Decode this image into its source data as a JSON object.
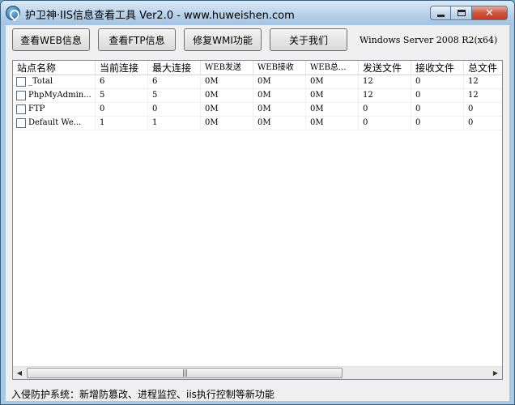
{
  "window": {
    "title": "护卫神·IIS信息查看工具 Ver2.0 - www.huweishen.com",
    "close_glyph": "✕"
  },
  "toolbar": {
    "web_info_label": "查看WEB信息",
    "ftp_info_label": "查看FTP信息",
    "repair_wmi_label": "修复WMI功能",
    "about_label": "关于我们",
    "os_label": "Windows Server 2008 R2(x64)"
  },
  "table": {
    "columns": [
      "站点名称",
      "当前连接",
      "最大连接",
      "WEB发送",
      "WEB接收",
      "WEB总...",
      "发送文件",
      "接收文件",
      "总文件"
    ],
    "rows": [
      [
        "_Total",
        "6",
        "6",
        "0M",
        "0M",
        "0M",
        "12",
        "0",
        "12"
      ],
      [
        "PhpMyAdmin...",
        "5",
        "5",
        "0M",
        "0M",
        "0M",
        "12",
        "0",
        "12"
      ],
      [
        "FTP",
        "0",
        "0",
        "0M",
        "0M",
        "0M",
        "0",
        "0",
        "0"
      ],
      [
        "Default We...",
        "1",
        "1",
        "0M",
        "0M",
        "0M",
        "0",
        "0",
        "0"
      ]
    ]
  },
  "scrollbar": {
    "left_arrow": "◀",
    "right_arrow": "▶",
    "grip": "|||"
  },
  "status": {
    "text": "入侵防护系统：新增防篡改、进程监控、iis执行控制等新功能"
  }
}
